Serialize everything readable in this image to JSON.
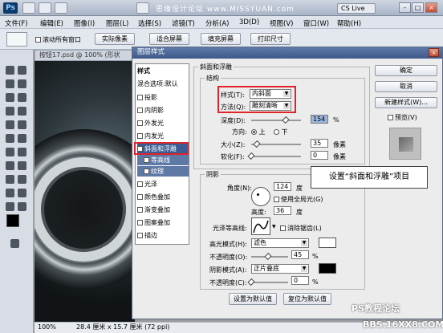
{
  "titlebar": {
    "app_logo": "Ps",
    "watermark": "思缘设计论坛 www.MISSYUAN.com",
    "cslive": "CS Live",
    "btn_min": "-",
    "btn_max": "□",
    "btn_close": "×"
  },
  "menu": [
    "文件(F)",
    "编辑(E)",
    "图像(I)",
    "图层(L)",
    "选择(S)",
    "滤镜(T)",
    "分析(A)",
    "3D(D)",
    "视图(V)",
    "窗口(W)",
    "帮助(H)"
  ],
  "options": {
    "scroll_all": "滚动所有窗口",
    "actual_pixels": "实际像素",
    "fit_screen": "适合屏幕",
    "fill_screen": "填充屏幕",
    "print_size": "打印尺寸"
  },
  "document": {
    "tab": "按钮17.psd @ 100% (形状"
  },
  "status": {
    "zoom": "100%",
    "size": "28.4 厘米 x 15.7 厘米 (72 ppi)"
  },
  "dialog": {
    "title": "图层样式",
    "close": "×",
    "style_header": "样式",
    "styles": [
      {
        "label": "混合选项:默认",
        "checked": false,
        "check": false
      },
      {
        "label": "投影",
        "check": true
      },
      {
        "label": "内阴影",
        "check": true
      },
      {
        "label": "外发光",
        "check": true
      },
      {
        "label": "内发光",
        "check": true
      },
      {
        "label": "斜面和浮雕",
        "check": true,
        "selected": true
      },
      {
        "label": "等高线",
        "check": true,
        "sub": true
      },
      {
        "label": "纹理",
        "check": true,
        "sub": true
      },
      {
        "label": "光泽",
        "check": true
      },
      {
        "label": "颜色叠加",
        "check": true
      },
      {
        "label": "渐变叠加",
        "check": true
      },
      {
        "label": "图案叠加",
        "check": true
      },
      {
        "label": "描边",
        "check": true
      }
    ],
    "bevel": {
      "group": "斜面和浮雕",
      "structure": "结构",
      "style_label": "样式(T):",
      "style_value": "内斜面",
      "technique_label": "方法(Q):",
      "technique_value": "雕刻清晰",
      "depth_label": "深度(D):",
      "depth_value": "154",
      "depth_unit": "%",
      "direction_label": "方向:",
      "dir_up": "上",
      "dir_down": "下",
      "size_label": "大小(Z):",
      "size_value": "35",
      "size_unit": "像素",
      "soften_label": "软化(F):",
      "soften_value": "0",
      "soften_unit": "像素"
    },
    "shading": {
      "group": "阴影",
      "angle_label": "角度(N):",
      "angle_value": "124",
      "angle_unit": "度",
      "global_light": "使用全局光(G)",
      "altitude_label": "高度:",
      "altitude_value": "36",
      "altitude_unit": "度",
      "gloss_label": "光泽等高线:",
      "anti_alias": "消除锯齿(L)",
      "highlight_label": "高光模式(H):",
      "highlight_value": "滤色",
      "highlight_opacity_label": "不透明度(O):",
      "highlight_opacity": "45",
      "shadow_label": "阴影模式(A):",
      "shadow_value": "正片叠底",
      "shadow_opacity_label": "不透明度(C):",
      "shadow_opacity": "0",
      "pct": "%"
    },
    "make_default": "设置为默认值",
    "reset_default": "复位为默认值",
    "ok": "确定",
    "cancel": "取消",
    "new_style": "新建样式(W)...",
    "preview": "预览(V)"
  },
  "annotation": "设置“斜面和浮雕”项目",
  "bottom_watermark": {
    "line1": "PS教程论坛",
    "line2": "BBS.16XX8.COM"
  },
  "colors": {
    "highlight_swatch": "#ffffff",
    "shadow_swatch": "#000000",
    "accent_red": "#e0242b",
    "dialog_title": "#3e5987"
  }
}
